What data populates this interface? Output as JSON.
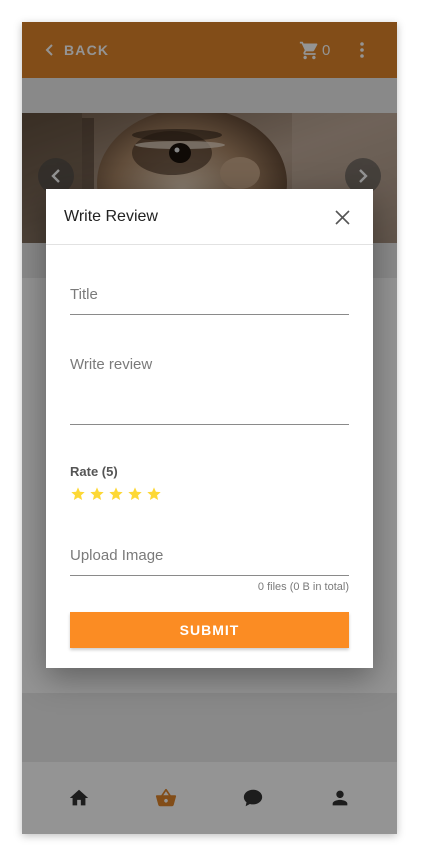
{
  "topbar": {
    "back_label": "BACK",
    "cart_count": "0",
    "back_icon": "chevron-left-icon",
    "cart_icon": "cart-icon",
    "more_icon": "more-vert-icon",
    "bg_color": "#e0862a"
  },
  "hero": {
    "image_subject": "chipmunk close-up photo",
    "prev_icon": "chevron-left-icon",
    "next_icon": "chevron-right-icon"
  },
  "dialog": {
    "title": "Write Review",
    "close_icon": "close-icon",
    "fields": {
      "title_placeholder": "Title",
      "review_placeholder": "Write review",
      "upload_placeholder": "Upload Image"
    },
    "rate": {
      "label": "Rate (5)",
      "value": 5,
      "max": 5,
      "star_color": "#fdd835"
    },
    "upload_meta": "0 files (0 B in total)",
    "submit_label": "SUBMIT",
    "submit_color": "#fb8c23"
  },
  "bottom_nav": {
    "items": [
      {
        "icon": "home-icon",
        "active": false
      },
      {
        "icon": "basket-icon",
        "active": true
      },
      {
        "icon": "chat-icon",
        "active": false
      },
      {
        "icon": "person-icon",
        "active": false
      }
    ],
    "active_color": "#e0862a",
    "inactive_color": "#333333"
  }
}
